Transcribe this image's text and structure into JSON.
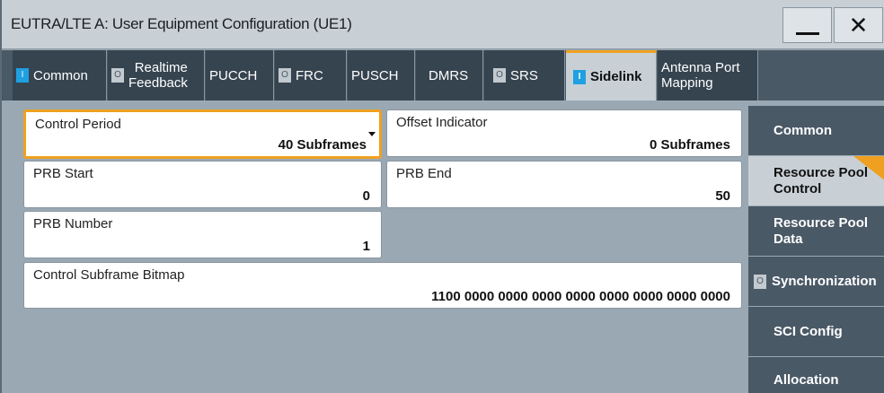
{
  "window": {
    "title": "EUTRA/LTE A: User Equipment Configuration (UE1)",
    "minimize_glyph": "",
    "close_glyph": "✕"
  },
  "tabs": [
    {
      "label": "Common",
      "indicator": "I",
      "state": "on"
    },
    {
      "label_line1": "Realtime",
      "label_line2": "Feedback",
      "indicator": "O",
      "state": "off"
    },
    {
      "label": "PUCCH"
    },
    {
      "label": "FRC",
      "indicator": "O",
      "state": "off"
    },
    {
      "label": "PUSCH"
    },
    {
      "label": "DMRS"
    },
    {
      "label": "SRS",
      "indicator": "O",
      "state": "off"
    },
    {
      "label": "Sidelink",
      "indicator": "I",
      "state": "on",
      "active": true
    },
    {
      "label_line1": "Antenna Port",
      "label_line2": "Mapping"
    }
  ],
  "fields": {
    "control_period": {
      "label": "Control Period",
      "value": "40 Subframes"
    },
    "offset_indicator": {
      "label": "Offset Indicator",
      "value": "0 Subframes"
    },
    "prb_start": {
      "label": "PRB Start",
      "value": "0"
    },
    "prb_end": {
      "label": "PRB End",
      "value": "50"
    },
    "prb_number": {
      "label": "PRB Number",
      "value": "1"
    },
    "control_subframe_bitmap": {
      "label": "Control Subframe Bitmap",
      "value": "1100 0000 0000 0000 0000 0000 0000 0000 0000"
    }
  },
  "sidenav": [
    {
      "label": "Common"
    },
    {
      "label_line1": "Resource Pool",
      "label_line2": "Control",
      "active": true
    },
    {
      "label_line1": "Resource Pool",
      "label_line2": "Data"
    },
    {
      "label": "Synchronization",
      "indicator": "O"
    },
    {
      "label": "SCI Config"
    },
    {
      "label": "Allocation"
    }
  ],
  "colors": {
    "accent": "#f0a020",
    "indicator_on": "#1fa0e0",
    "tab_bg": "#364450",
    "panel_bg": "#9aa8b3"
  }
}
